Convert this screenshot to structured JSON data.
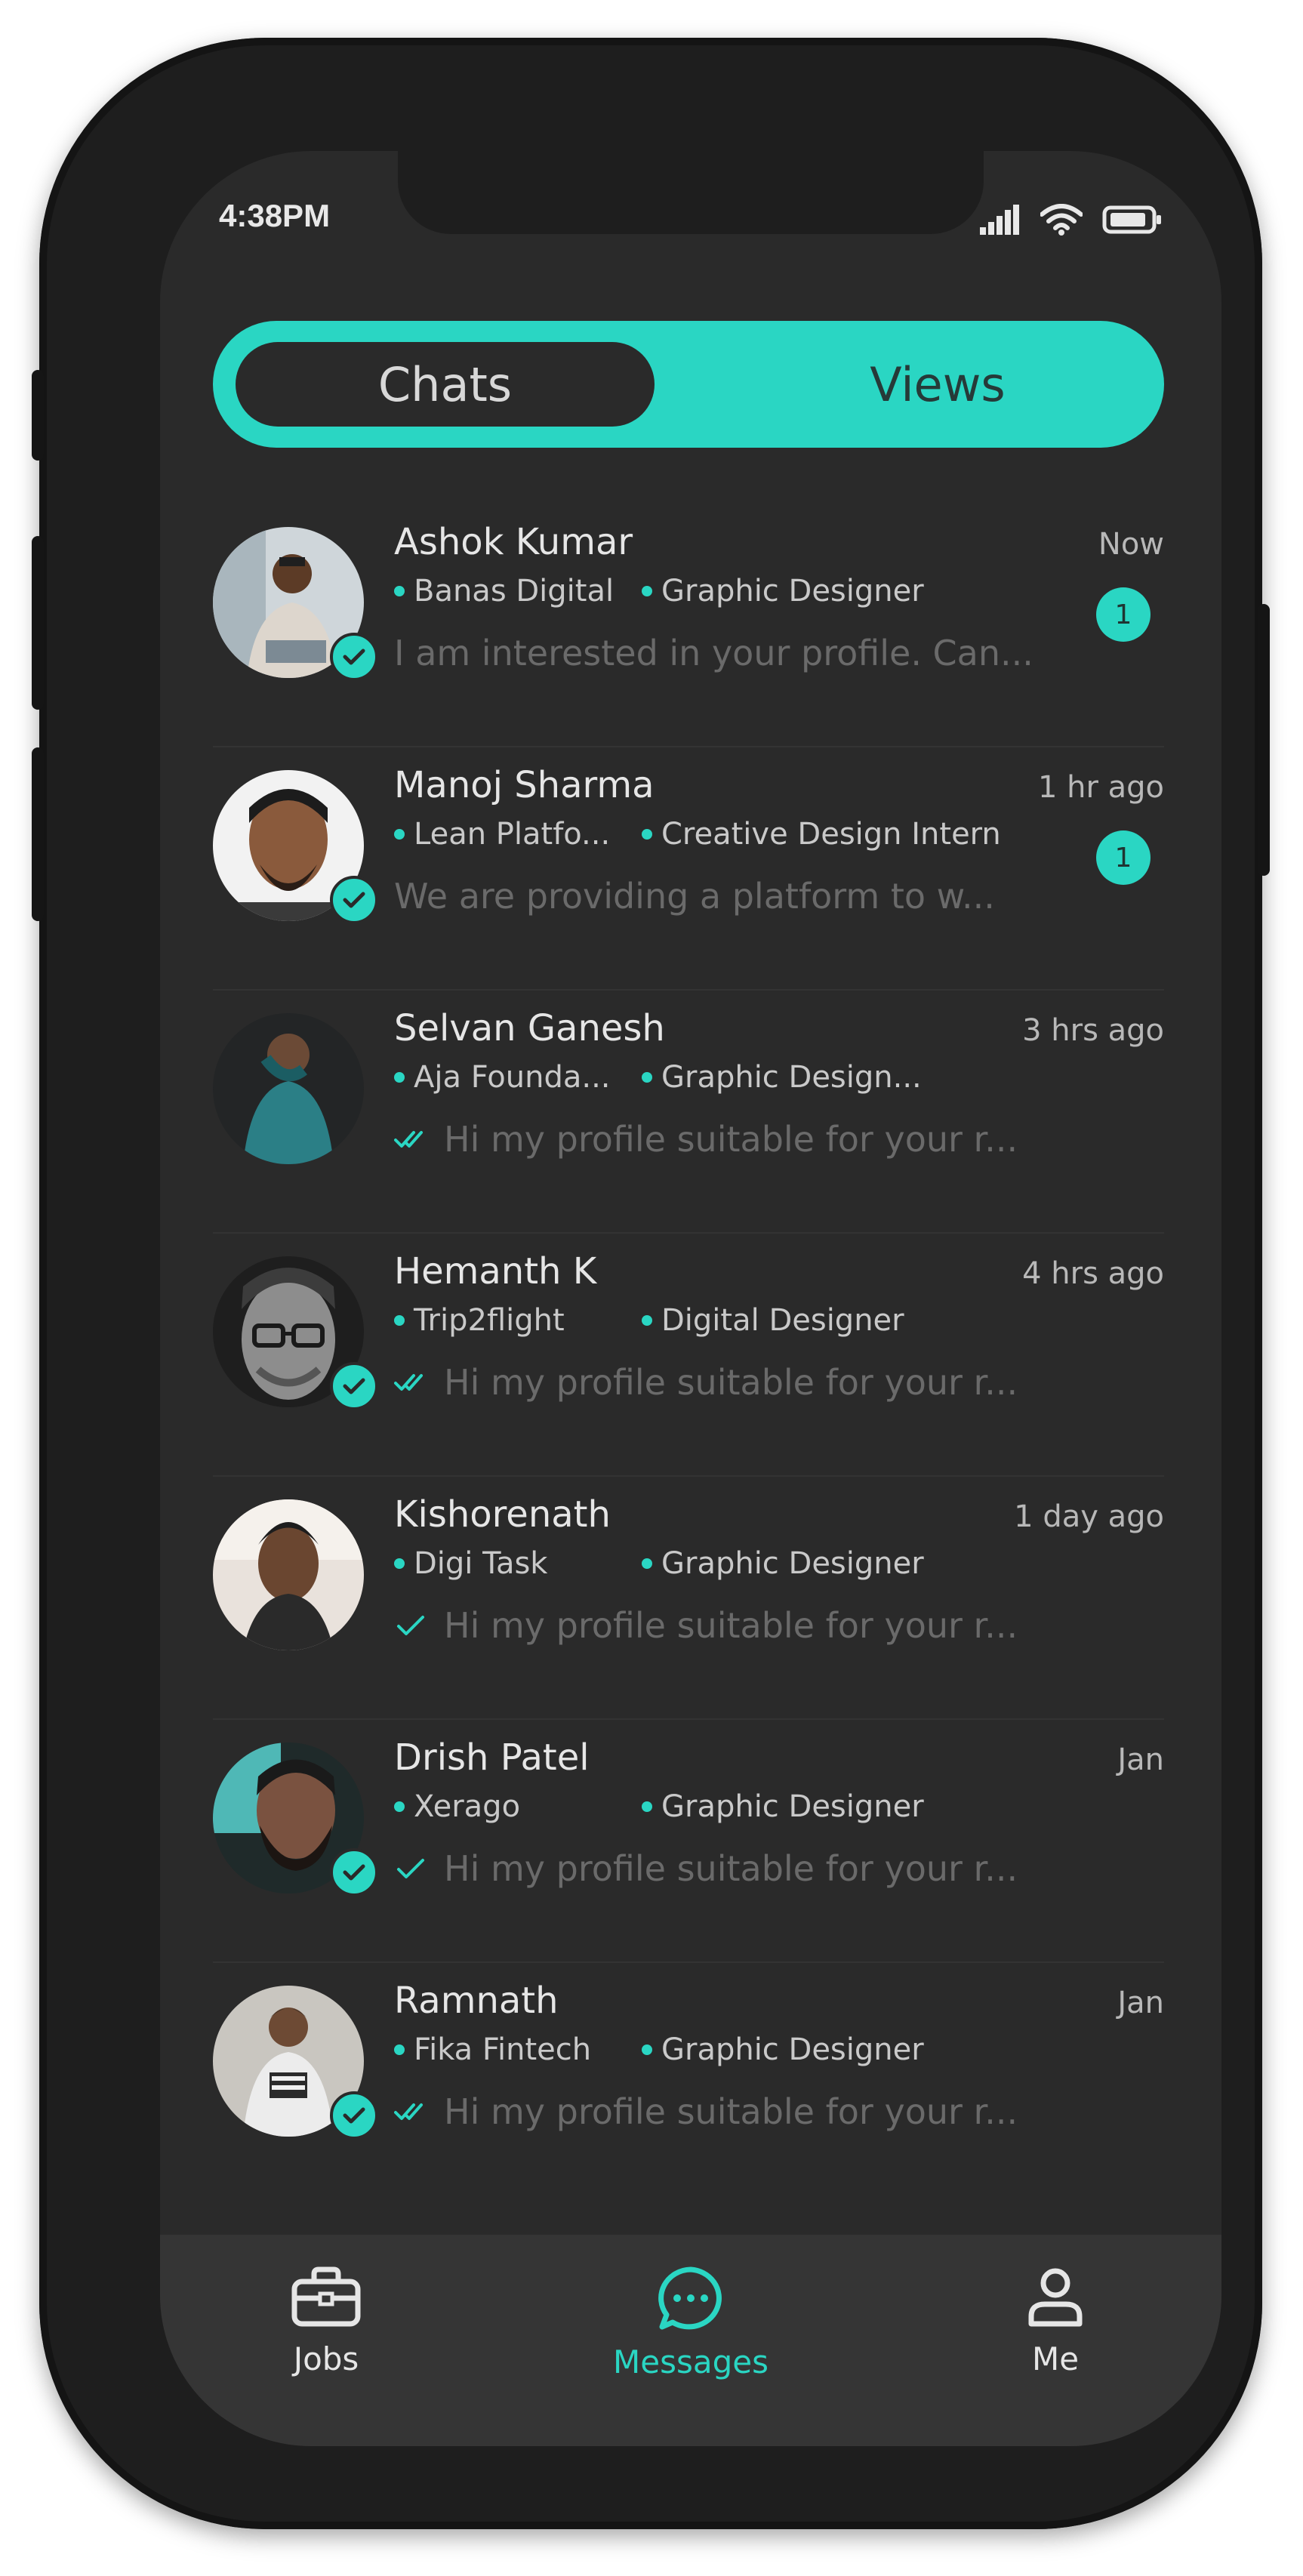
{
  "status_bar": {
    "time": "4:38PM"
  },
  "tabs": {
    "active": "Chats",
    "inactive": "Views"
  },
  "colors": {
    "accent": "#2ad6c3",
    "background": "#2a2a2a",
    "text": "#e6e6e6",
    "muted": "#6a6a6a"
  },
  "chats": [
    {
      "name": "Ashok Kumar",
      "company": "Banas Digital",
      "role": "Graphic Designer",
      "message": "I am interested in your profile. Can...",
      "time": "Now",
      "unread": "1",
      "status": "none",
      "verified": true
    },
    {
      "name": "Manoj  Sharma",
      "company": "Lean Platfo...",
      "role": "Creative Design Intern",
      "message": "We are providing a platform to w...",
      "time": "1 hr ago",
      "unread": "1",
      "status": "none",
      "verified": true
    },
    {
      "name": "Selvan Ganesh",
      "company": "Aja Founda...",
      "role": "Graphic Design...",
      "message": "Hi my profile suitable for your r...",
      "time": "3 hrs ago",
      "unread": "",
      "status": "read",
      "verified": false
    },
    {
      "name": "Hemanth K",
      "company": "Trip2flight",
      "role": "Digital Designer",
      "message": "Hi my profile suitable for your r...",
      "time": "4 hrs ago",
      "unread": "",
      "status": "read",
      "verified": true
    },
    {
      "name": "Kishorenath",
      "company": "Digi Task",
      "role": "Graphic Designer",
      "message": "Hi my profile suitable for your r...",
      "time": "1 day ago",
      "unread": "",
      "status": "sent",
      "verified": false
    },
    {
      "name": "Drish Patel",
      "company": "Xerago",
      "role": "Graphic Designer",
      "message": "Hi my profile suitable for your r...",
      "time": "Jan",
      "unread": "",
      "status": "sent",
      "verified": true
    },
    {
      "name": "Ramnath",
      "company": "Fika Fintech",
      "role": "Graphic Designer",
      "message": "Hi my profile suitable for your r...",
      "time": "Jan",
      "unread": "",
      "status": "read",
      "verified": true
    }
  ],
  "bottom_nav": [
    {
      "label": "Jobs",
      "icon": "briefcase-icon",
      "active": false
    },
    {
      "label": "Messages",
      "icon": "chat-bubble-icon",
      "active": true
    },
    {
      "label": "Me",
      "icon": "user-icon",
      "active": false
    }
  ]
}
